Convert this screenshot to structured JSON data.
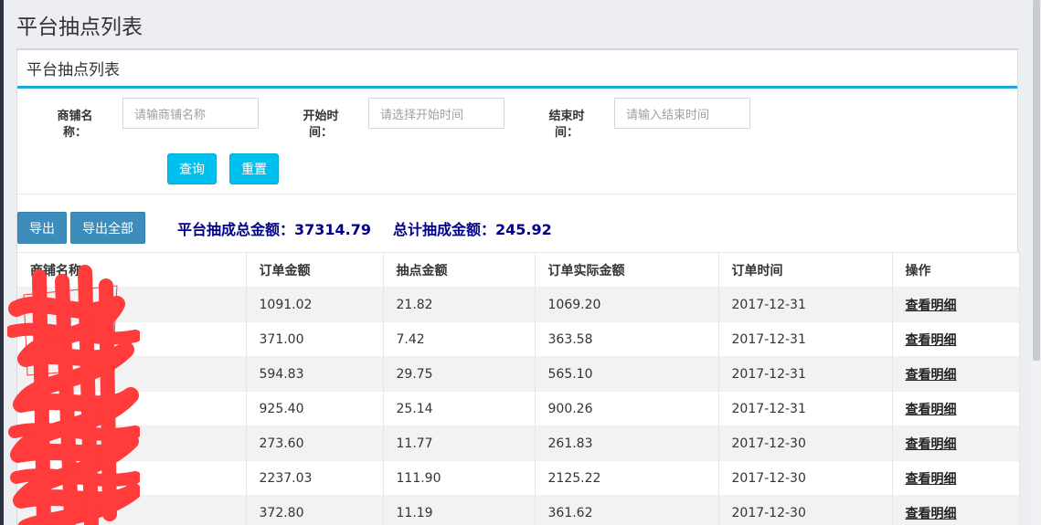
{
  "page": {
    "title": "平台抽点列表"
  },
  "box": {
    "title": "平台抽点列表"
  },
  "filters": {
    "shop_label": "商铺名称：",
    "shop_placeholder": "请输商铺名称",
    "start_label": "开始时间：",
    "start_placeholder": "请选择开始时间",
    "end_label": "结束时间：",
    "end_placeholder": "请输入结束时间",
    "query_button": "查询",
    "reset_button": "重置"
  },
  "toolbar": {
    "export_button": "导出",
    "export_all_button": "导出全部",
    "total_commission": "平台抽成总金额：37314.79",
    "sum_commission": "总计抽成金额：245.92"
  },
  "table": {
    "headers": [
      "商铺名称",
      "订单金额",
      "抽点金额",
      "订单实际金额",
      "订单时间",
      "操作"
    ],
    "rows": [
      {
        "shop": "",
        "amount": "1091.02",
        "commission": "21.82",
        "actual": "1069.20",
        "date": "2017-12-31",
        "action": "查看明细"
      },
      {
        "shop": "",
        "amount": "371.00",
        "commission": "7.42",
        "actual": "363.58",
        "date": "2017-12-31",
        "action": "查看明细"
      },
      {
        "shop": "",
        "amount": "594.83",
        "commission": "29.75",
        "actual": "565.10",
        "date": "2017-12-31",
        "action": "查看明细"
      },
      {
        "shop": "",
        "amount": "925.40",
        "commission": "25.14",
        "actual": "900.26",
        "date": "2017-12-31",
        "action": "查看明细"
      },
      {
        "shop": "",
        "amount": "273.60",
        "commission": "11.77",
        "actual": "261.83",
        "date": "2017-12-30",
        "action": "查看明细"
      },
      {
        "shop": "",
        "amount": "2237.03",
        "commission": "111.90",
        "actual": "2125.22",
        "date": "2017-12-30",
        "action": "查看明细"
      },
      {
        "shop": "",
        "amount": "372.80",
        "commission": "11.19",
        "actual": "361.62",
        "date": "2017-12-30",
        "action": "查看明细"
      }
    ]
  },
  "colors": {
    "accent": "#1aa7dc",
    "query_button": "#00c0ef",
    "export_button": "#3c8dbc",
    "summary_text": "#00008b",
    "redaction": "#ff3b3b"
  }
}
